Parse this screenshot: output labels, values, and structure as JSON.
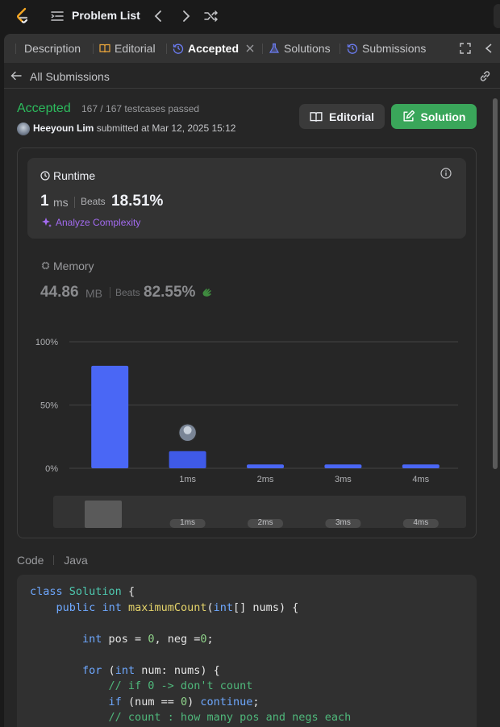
{
  "topnav": {
    "title": "Problem List"
  },
  "tabs": [
    {
      "label": "Description",
      "icon": "description-icon"
    },
    {
      "label": "Editorial",
      "icon": "book-icon"
    },
    {
      "label": "Accepted",
      "icon": "history-icon",
      "active": true
    },
    {
      "label": "Solutions",
      "icon": "flask-icon"
    },
    {
      "label": "Submissions",
      "icon": "history-icon"
    }
  ],
  "subbar": {
    "back_label": "All Submissions"
  },
  "result": {
    "status": "Accepted",
    "testcases": "167 / 167 testcases passed",
    "user": "Heeyoun Lim",
    "submitted": "submitted at Mar 12, 2025 15:12",
    "editorial_btn": "Editorial",
    "solution_btn": "Solution"
  },
  "runtime": {
    "label": "Runtime",
    "value": "1",
    "unit": "ms",
    "beats_label": "Beats",
    "beats_pct": "18.51%",
    "analyze": "Analyze Complexity"
  },
  "memory": {
    "label": "Memory",
    "value": "44.86",
    "unit": "MB",
    "beats_label": "Beats",
    "beats_pct": "82.55%"
  },
  "chart_data": {
    "type": "bar",
    "categories": [
      "",
      "1ms",
      "2ms",
      "3ms",
      "4ms"
    ],
    "values": [
      81,
      13.5,
      3,
      3,
      3
    ],
    "ylim": [
      0,
      100
    ],
    "yticks": [
      "0%",
      "50%",
      "100%"
    ],
    "grid": true,
    "highlight_index": 1,
    "overview_labels": [
      "1ms",
      "2ms",
      "3ms",
      "4ms"
    ]
  },
  "code": {
    "label": "Code",
    "lang": "Java",
    "lines": [
      "class Solution {",
      "    public int maximumCount(int[] nums) {",
      "",
      "        int pos = 0, neg =0;",
      "",
      "        for (int num: nums) {",
      "            // if 0 -> don't count",
      "            if (num == 0) continue;",
      "            // count : how many pos and negs each"
    ]
  },
  "colors": {
    "accent_green": "#2cbb5d",
    "bar_blue": "#4a67f5",
    "purple": "#a36bf0"
  }
}
